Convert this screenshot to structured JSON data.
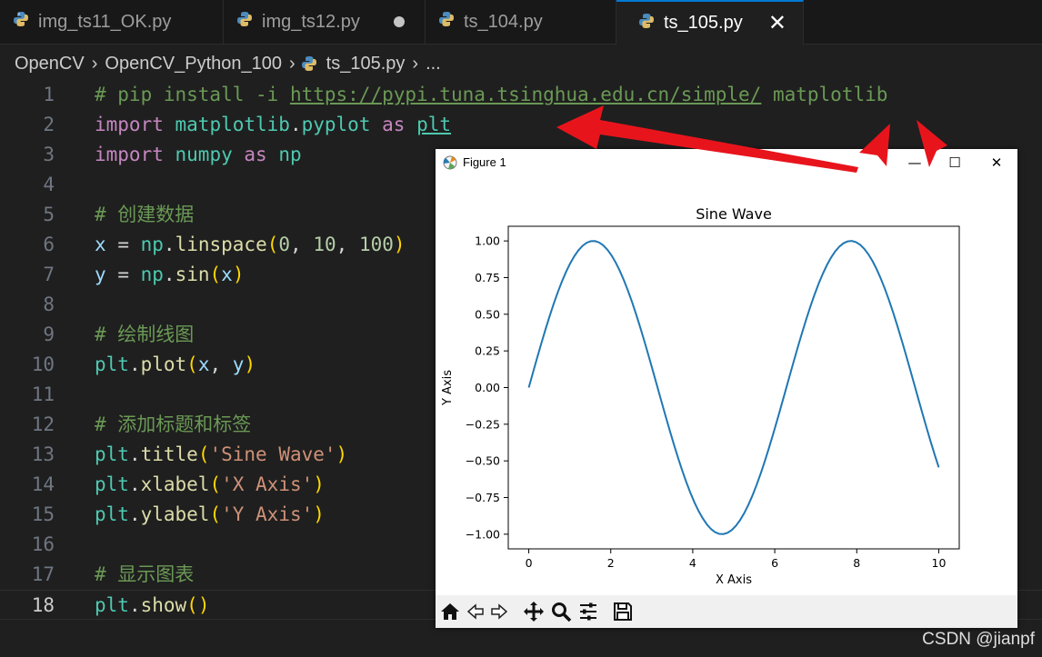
{
  "tabs": [
    {
      "label": "img_ts11_OK.py",
      "state": "normal"
    },
    {
      "label": "img_ts12.py",
      "state": "modified"
    },
    {
      "label": "ts_104.py",
      "state": "normal"
    },
    {
      "label": "ts_105.py",
      "state": "active"
    }
  ],
  "breadcrumb": [
    "OpenCV",
    "OpenCV_Python_100",
    "ts_105.py",
    "..."
  ],
  "code_lines": [
    {
      "n": "1",
      "text": "# pip install -i https://pypi.tuna.tsinghua.edu.cn/simple/ matplotlib"
    },
    {
      "n": "2",
      "text": "import matplotlib.pyplot as plt"
    },
    {
      "n": "3",
      "text": "import numpy as np"
    },
    {
      "n": "4",
      "text": ""
    },
    {
      "n": "5",
      "text": "# 创建数据"
    },
    {
      "n": "6",
      "text": "x = np.linspace(0, 10, 100)"
    },
    {
      "n": "7",
      "text": "y = np.sin(x)"
    },
    {
      "n": "8",
      "text": ""
    },
    {
      "n": "9",
      "text": "# 绘制线图"
    },
    {
      "n": "10",
      "text": "plt.plot(x, y)"
    },
    {
      "n": "11",
      "text": ""
    },
    {
      "n": "12",
      "text": "# 添加标题和标签"
    },
    {
      "n": "13",
      "text": "plt.title('Sine Wave')"
    },
    {
      "n": "14",
      "text": "plt.xlabel('X Axis')"
    },
    {
      "n": "15",
      "text": "plt.ylabel('Y Axis')"
    },
    {
      "n": "16",
      "text": ""
    },
    {
      "n": "17",
      "text": "# 显示图表"
    },
    {
      "n": "18",
      "text": "plt.show()"
    }
  ],
  "figure_window": {
    "title": "Figure 1",
    "toolbar_icons": [
      "home-icon",
      "back-icon",
      "forward-icon",
      "pan-icon",
      "zoom-icon",
      "configure-icon",
      "save-icon"
    ]
  },
  "chart_data": {
    "type": "line",
    "title": "Sine Wave",
    "xlabel": "X Axis",
    "ylabel": "Y Axis",
    "xlim": [
      -0.5,
      10.5
    ],
    "ylim": [
      -1.1,
      1.1
    ],
    "xticks": [
      "0",
      "2",
      "4",
      "6",
      "8",
      "10"
    ],
    "yticks": [
      "1.00",
      "0.75",
      "0.50",
      "0.25",
      "0.00",
      "−0.25",
      "−0.50",
      "−0.75",
      "−1.00"
    ],
    "series": [
      {
        "color": "#1f77b4",
        "function": "y = sin(x)",
        "x_start": 0,
        "x_end": 10,
        "points": 100
      }
    ],
    "grid": false
  },
  "watermark": "CSDN @jianpf",
  "colors": {
    "accent": "#0078d4",
    "arrow": "#e8141c",
    "line": "#1f77b4"
  }
}
